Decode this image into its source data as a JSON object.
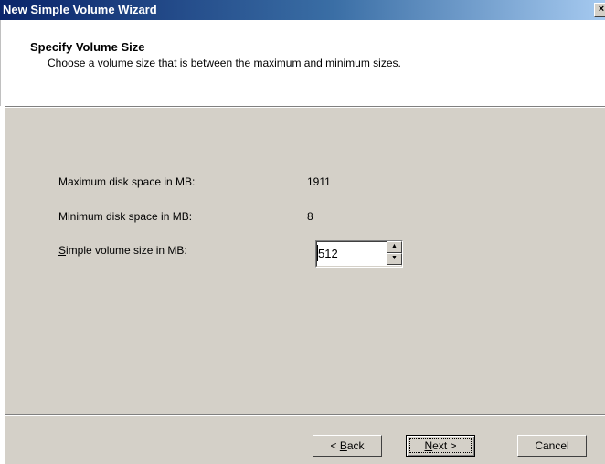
{
  "window": {
    "title": "New Simple Volume Wizard",
    "close_glyph": "×"
  },
  "header": {
    "heading": "Specify Volume Size",
    "subheading": "Choose a volume size that is between the maximum and minimum sizes."
  },
  "fields": {
    "max_label": "Maximum disk space in MB:",
    "max_value": "1911",
    "min_label": "Minimum disk space in MB:",
    "min_value": "8",
    "size_label_mnemonic": "S",
    "size_label_rest": "imple volume size in MB:",
    "size_value": "512",
    "spin_up_glyph": "▲",
    "spin_down_glyph": "▼"
  },
  "buttons": {
    "back_prefix": "< ",
    "back_mnemonic": "B",
    "back_rest": "ack",
    "next_mnemonic": "N",
    "next_rest": "ext >",
    "cancel": "Cancel"
  },
  "colors": {
    "titlebar_start": "#0a246a",
    "dialog_face": "#d4d0c8"
  }
}
